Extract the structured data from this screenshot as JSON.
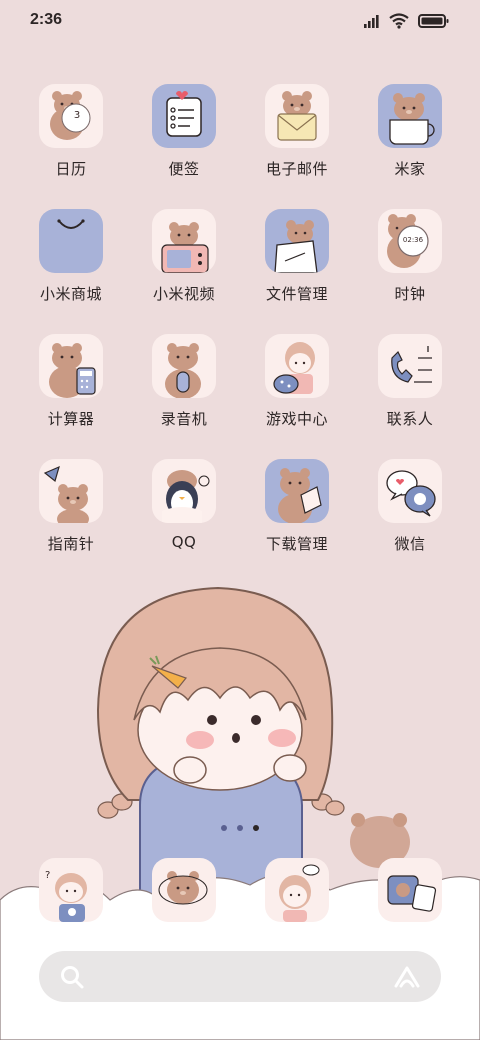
{
  "status_bar": {
    "time": "2:36"
  },
  "apps": [
    {
      "label": "日历",
      "icon": "calendar-bear-icon",
      "badge": "3"
    },
    {
      "label": "便签",
      "icon": "notes-icon"
    },
    {
      "label": "电子邮件",
      "icon": "email-bear-icon"
    },
    {
      "label": "米家",
      "icon": "mijia-cup-bear-icon"
    },
    {
      "label": "小米商城",
      "icon": "mi-store-bag-icon"
    },
    {
      "label": "小米视频",
      "icon": "video-bear-icon"
    },
    {
      "label": "文件管理",
      "icon": "file-bear-icon"
    },
    {
      "label": "时钟",
      "icon": "clock-bear-icon",
      "clock_text": "02:36"
    },
    {
      "label": "计算器",
      "icon": "calculator-bear-icon"
    },
    {
      "label": "录音机",
      "icon": "recorder-bear-icon"
    },
    {
      "label": "游戏中心",
      "icon": "game-girl-icon"
    },
    {
      "label": "联系人",
      "icon": "phone-icon"
    },
    {
      "label": "指南针",
      "icon": "compass-bear-icon"
    },
    {
      "label": "QQ",
      "icon": "qq-penguin-icon"
    },
    {
      "label": "下载管理",
      "icon": "download-bear-icon"
    },
    {
      "label": "微信",
      "icon": "wechat-chat-icon"
    }
  ],
  "dock": [
    {
      "icon": "phone-girl-icon"
    },
    {
      "icon": "messages-bear-icon"
    },
    {
      "icon": "browser-girl-icon"
    },
    {
      "icon": "camera-icon"
    }
  ],
  "search": {
    "left_icon": "search-icon",
    "right_icon": "assistant-icon"
  },
  "colors": {
    "background": "#eddcdc",
    "tile": "#fbeeec",
    "tile_blue": "#a8b2d8",
    "bear": "#c99a84"
  }
}
